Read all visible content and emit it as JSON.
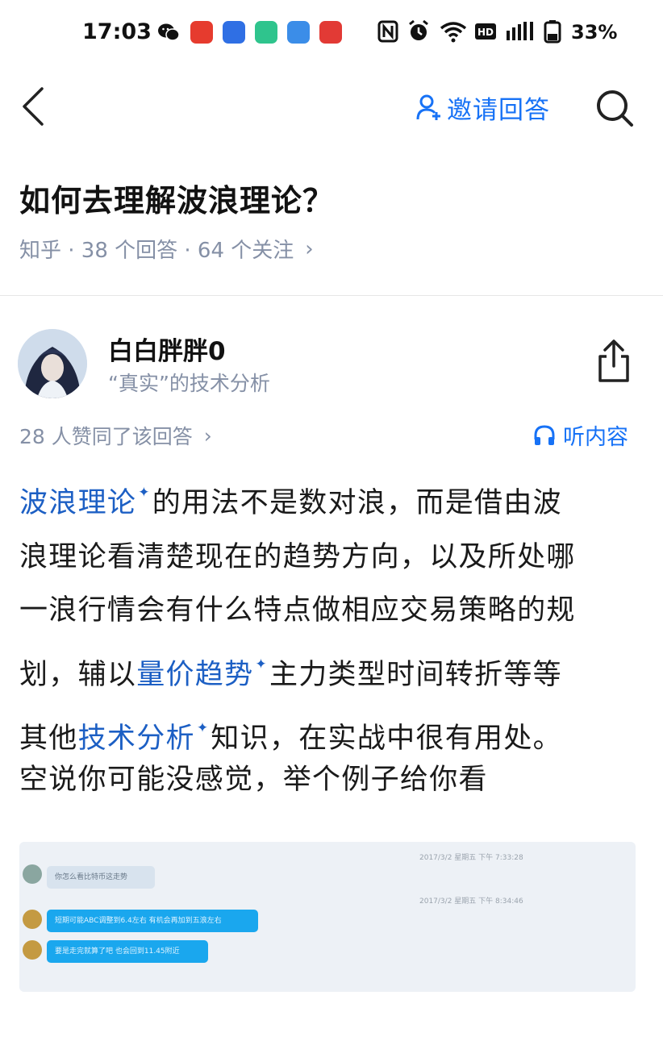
{
  "status_bar": {
    "time": "17:03",
    "battery": "33%",
    "app_icons": [
      "wechat-icon",
      "app-red-icon",
      "app-blue-icon",
      "app-green-icon",
      "app-blue-square-icon",
      "app-red-chart-icon"
    ],
    "system_icons": [
      "nfc-icon",
      "alarm-icon",
      "wifi-icon",
      "hd-icon",
      "signal-icon",
      "battery-icon"
    ]
  },
  "nav": {
    "invite_label": "邀请回答"
  },
  "question": {
    "title": "如何去理解波浪理论？",
    "meta": "知乎 · 38 个回答 · 64 个关注",
    "meta_chevron": "›"
  },
  "author": {
    "name": "白白胖胖0",
    "bio": "“真实”的技术分析"
  },
  "answer": {
    "votes": "28 人赞同了该回答",
    "votes_chevron": "›",
    "listen_label": "听内容",
    "lines": {
      "l1_kw": "波浪理论",
      "l1_rest": "的用法不是数对浪，而是借由波",
      "l2": "浪理论看清楚现在的趋势方向，以及所处哪",
      "l3": "一浪行情会有什么特点做相应交易策略的规",
      "l4_pre": "划，辅以",
      "l4_kw": "量价趋势",
      "l4_rest": "主力类型时间转折等等",
      "l5_pre": "其他",
      "l5_kw": "技术分析",
      "l5_rest": "知识，在实战中很有用处。"
    },
    "spark_symbol": "✦",
    "second_paragraph": "空说你可能没感觉，举个例子给你看"
  },
  "chat_image": {
    "timestamp_1": "2017/3/2 星期五 下午 7:33:28",
    "timestamp_2": "2017/3/2 星期五 下午 8:34:46",
    "bubble_1": "你怎么看比特币这走势",
    "bubble_2": "短期可能ABC调整到6.4左右 有机会再加到五浪左右",
    "bubble_3": "要是走完就算了吧 也会回到11.45附近"
  },
  "colors": {
    "accent": "#1772f6",
    "keyword": "#1c5fc4",
    "muted": "#8590a6",
    "chat_bubble": "#1aa7ee"
  }
}
